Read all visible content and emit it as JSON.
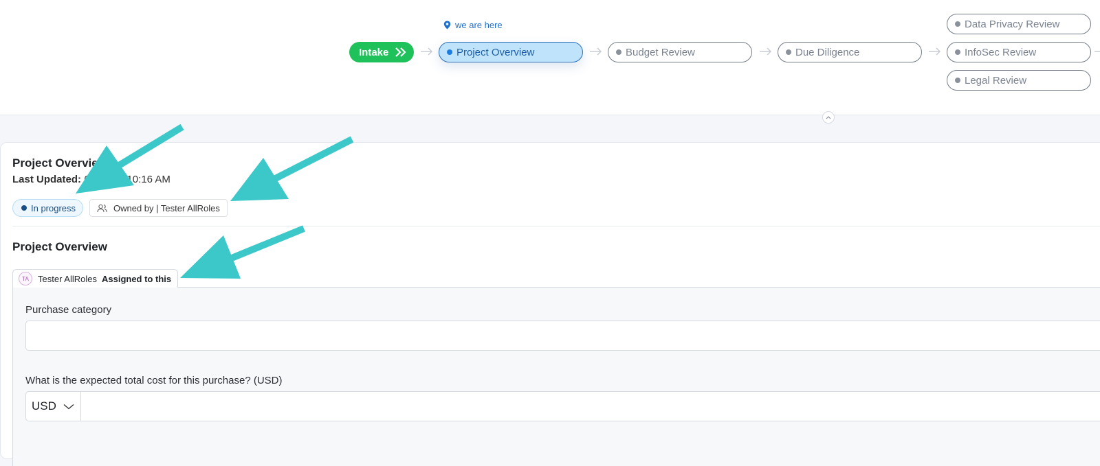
{
  "workflow": {
    "location_hint": "we are here",
    "steps": [
      {
        "label": "Intake",
        "state": "done"
      },
      {
        "label": "Project Overview",
        "state": "current"
      },
      {
        "label": "Budget Review",
        "state": "pending"
      },
      {
        "label": "Due Diligence",
        "state": "pending"
      }
    ],
    "parallel_steps": [
      {
        "label": "Data Privacy Review"
      },
      {
        "label": "InfoSec Review"
      },
      {
        "label": "Legal Review"
      }
    ]
  },
  "card": {
    "title": "Project Overview",
    "last_updated_label": "Last Updated:",
    "last_updated_value": "6/__/25 | 10:16 AM",
    "status": "In progress",
    "owner": "Owned by | Tester AllRoles"
  },
  "section": {
    "title": "Project Overview",
    "assignee_initials": "TA",
    "assignee_name": "Tester AllRoles",
    "assigned_text": "Assigned to this"
  },
  "form": {
    "purchase_category_label": "Purchase category",
    "purchase_category_value": "",
    "cost_label": "What is the expected total cost for this purchase? (USD)",
    "currency": "USD",
    "cost_value": ""
  },
  "colors": {
    "intake_green": "#1fc15a",
    "active_blue": "#bfe3fb",
    "annotation_teal": "#3cc8c8"
  }
}
